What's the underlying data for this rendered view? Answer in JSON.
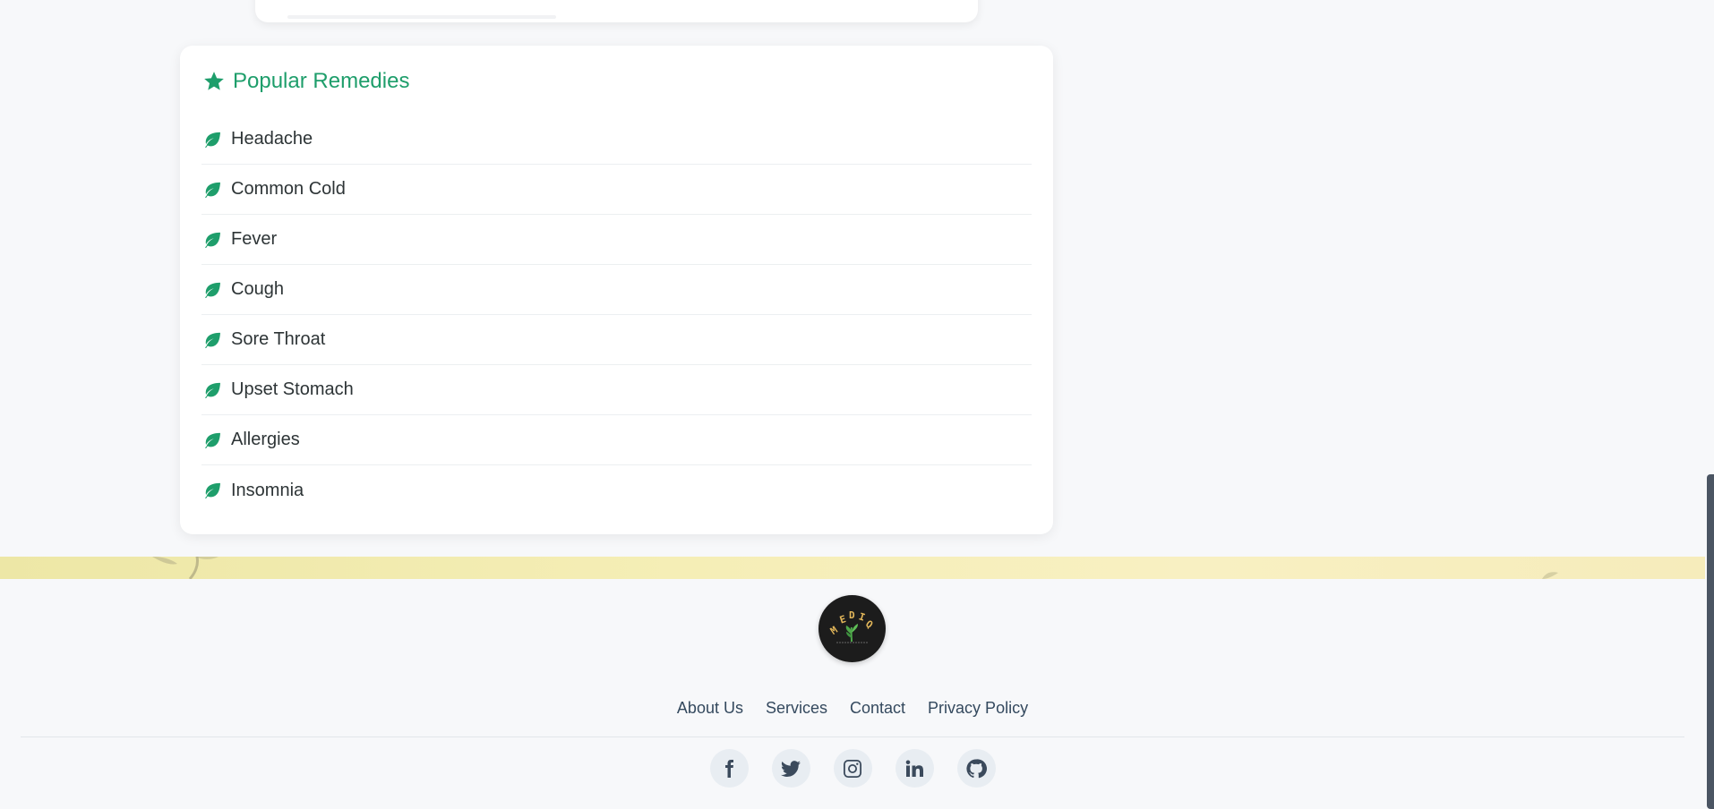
{
  "remedies": {
    "title": "Popular Remedies",
    "title_icon": "star-icon",
    "item_icon": "leaf-icon",
    "accent_color": "#1e9e6b",
    "items": [
      {
        "label": "Headache"
      },
      {
        "label": "Common Cold"
      },
      {
        "label": "Fever"
      },
      {
        "label": "Cough"
      },
      {
        "label": "Sore Throat"
      },
      {
        "label": "Upset Stomach"
      },
      {
        "label": "Allergies"
      },
      {
        "label": "Insomnia"
      }
    ]
  },
  "footer": {
    "logo_text": "MEDIQ",
    "links": [
      {
        "label": "About Us"
      },
      {
        "label": "Services"
      },
      {
        "label": "Contact"
      },
      {
        "label": "Privacy Policy"
      }
    ],
    "social": [
      {
        "icon": "facebook-icon"
      },
      {
        "icon": "twitter-icon"
      },
      {
        "icon": "instagram-icon"
      },
      {
        "icon": "linkedin-icon"
      },
      {
        "icon": "github-icon"
      }
    ]
  }
}
